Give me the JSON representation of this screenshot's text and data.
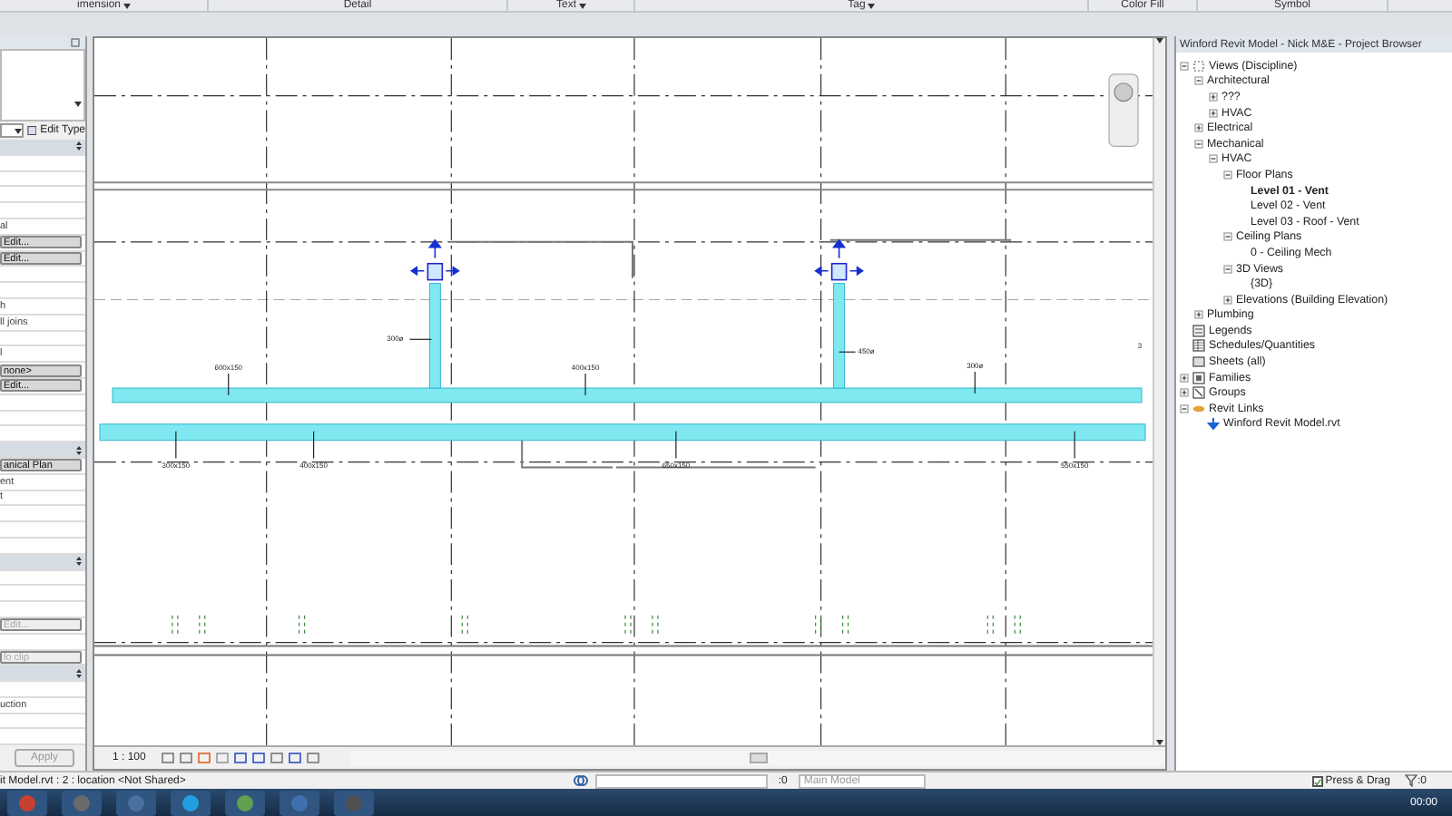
{
  "ribbon": {
    "panels": [
      {
        "label": "imension",
        "dropdown": true
      },
      {
        "label": "Detail",
        "dropdown": false
      },
      {
        "label": "Text",
        "dropdown": true
      },
      {
        "label": "Tag",
        "dropdown": true
      },
      {
        "label": "Color Fill",
        "dropdown": false
      },
      {
        "label": "Symbol",
        "dropdown": false
      }
    ]
  },
  "properties": {
    "edit_type": "Edit Type",
    "apply": "Apply",
    "rows": [
      {
        "kind": "header"
      },
      {
        "kind": "text",
        "text": ""
      },
      {
        "kind": "text",
        "text": ""
      },
      {
        "kind": "text",
        "text": ""
      },
      {
        "kind": "text",
        "text": ""
      },
      {
        "kind": "text",
        "text": "al"
      },
      {
        "kind": "button",
        "text": "Edit...",
        "disabled": false
      },
      {
        "kind": "button",
        "text": "Edit...",
        "disabled": false
      },
      {
        "kind": "text",
        "text": ""
      },
      {
        "kind": "text",
        "text": ""
      },
      {
        "kind": "text",
        "text": "h"
      },
      {
        "kind": "text",
        "text": "ll joins"
      },
      {
        "kind": "text",
        "text": ""
      },
      {
        "kind": "text",
        "text": "l"
      },
      {
        "kind": "button",
        "text": "none>",
        "disabled": false
      },
      {
        "kind": "button",
        "text": "Edit...",
        "disabled": false
      },
      {
        "kind": "text",
        "text": ""
      },
      {
        "kind": "text",
        "text": ""
      },
      {
        "kind": "text",
        "text": ""
      },
      {
        "kind": "header"
      },
      {
        "kind": "button",
        "text": "anical Plan",
        "disabled": false
      },
      {
        "kind": "text",
        "text": "ent"
      },
      {
        "kind": "text",
        "text": "t"
      },
      {
        "kind": "text",
        "text": ""
      },
      {
        "kind": "text",
        "text": ""
      },
      {
        "kind": "text",
        "text": ""
      },
      {
        "kind": "header"
      },
      {
        "kind": "text",
        "text": ""
      },
      {
        "kind": "text",
        "text": ""
      },
      {
        "kind": "text",
        "text": ""
      },
      {
        "kind": "button",
        "text": "Edit...",
        "disabled": true
      },
      {
        "kind": "text",
        "text": ""
      },
      {
        "kind": "button",
        "text": "lo clip",
        "disabled": true
      },
      {
        "kind": "header"
      },
      {
        "kind": "text",
        "text": ""
      },
      {
        "kind": "text",
        "text": "uction"
      },
      {
        "kind": "text",
        "text": ""
      },
      {
        "kind": "text",
        "text": ""
      }
    ]
  },
  "drawing": {
    "tags": [
      {
        "text": "600x150",
        "kind": "leader-down"
      },
      {
        "text": "400x150",
        "kind": "leader-down"
      },
      {
        "text": "300ø",
        "kind": "leader-right"
      },
      {
        "text": "450ø",
        "kind": "leader-left"
      },
      {
        "text": "300ø",
        "kind": "leader-down"
      },
      {
        "text": "3",
        "kind": "plain"
      },
      {
        "text": "300x150",
        "kind": "leader-up"
      },
      {
        "text": "400x150",
        "kind": "leader-up"
      },
      {
        "text": "650x150",
        "kind": "leader-up"
      },
      {
        "text": "550x150",
        "kind": "leader-up"
      }
    ]
  },
  "view_bar": {
    "scale": "1 : 100"
  },
  "browser": {
    "title": "Winford Revit Model - Nick M&E - Project Browser",
    "tree": [
      {
        "label": "Views (Discipline)",
        "kind": "views",
        "expanded": true,
        "selected": false,
        "children": [
          {
            "label": "Architectural",
            "expanded": true,
            "selected": false,
            "children": [
              {
                "label": "???",
                "expanded": false,
                "selected": false
              },
              {
                "label": "HVAC",
                "expanded": false,
                "selected": false
              }
            ]
          },
          {
            "label": "Electrical",
            "expanded": false,
            "selected": false
          },
          {
            "label": "Mechanical",
            "expanded": true,
            "selected": false,
            "children": [
              {
                "label": "HVAC",
                "expanded": true,
                "selected": false,
                "children": [
                  {
                    "label": "Floor Plans",
                    "expanded": true,
                    "selected": false,
                    "children": [
                      {
                        "label": "Level 01 - Vent",
                        "selected": true
                      },
                      {
                        "label": "Level 02 - Vent",
                        "selected": false
                      },
                      {
                        "label": "Level 03 - Roof - Vent",
                        "selected": false
                      }
                    ]
                  },
                  {
                    "label": "Ceiling Plans",
                    "expanded": true,
                    "selected": false,
                    "children": [
                      {
                        "label": "0 - Ceiling Mech",
                        "selected": false
                      }
                    ]
                  },
                  {
                    "label": "3D Views",
                    "expanded": true,
                    "selected": false,
                    "children": [
                      {
                        "label": "{3D}",
                        "selected": false
                      }
                    ]
                  },
                  {
                    "label": "Elevations (Building Elevation)",
                    "expanded": false,
                    "selected": false
                  }
                ]
              }
            ]
          },
          {
            "label": "Plumbing",
            "expanded": false,
            "selected": false
          }
        ]
      },
      {
        "label": "Legends",
        "kind": "legends",
        "selected": false
      },
      {
        "label": "Schedules/Quantities",
        "kind": "schedules",
        "selected": false
      },
      {
        "label": "Sheets (all)",
        "kind": "sheets",
        "selected": false
      },
      {
        "label": "Families",
        "kind": "families",
        "expanded": false,
        "selected": false
      },
      {
        "label": "Groups",
        "kind": "groups",
        "expanded": false,
        "selected": false
      },
      {
        "label": "Revit Links",
        "kind": "links",
        "expanded": true,
        "selected": false,
        "children": [
          {
            "label": "Winford Revit Model.rvt",
            "kind": "linked-file",
            "selected": false
          }
        ]
      }
    ]
  },
  "status_bar": {
    "file": "it Model.rvt : 2 : location <Not Shared>",
    "selection_count": ":0",
    "model": "Main Model",
    "press_drag": {
      "label": "Press & Drag",
      "checked": true
    },
    "filter_count": ":0"
  },
  "taskbar": {
    "clock": "00:00"
  }
}
